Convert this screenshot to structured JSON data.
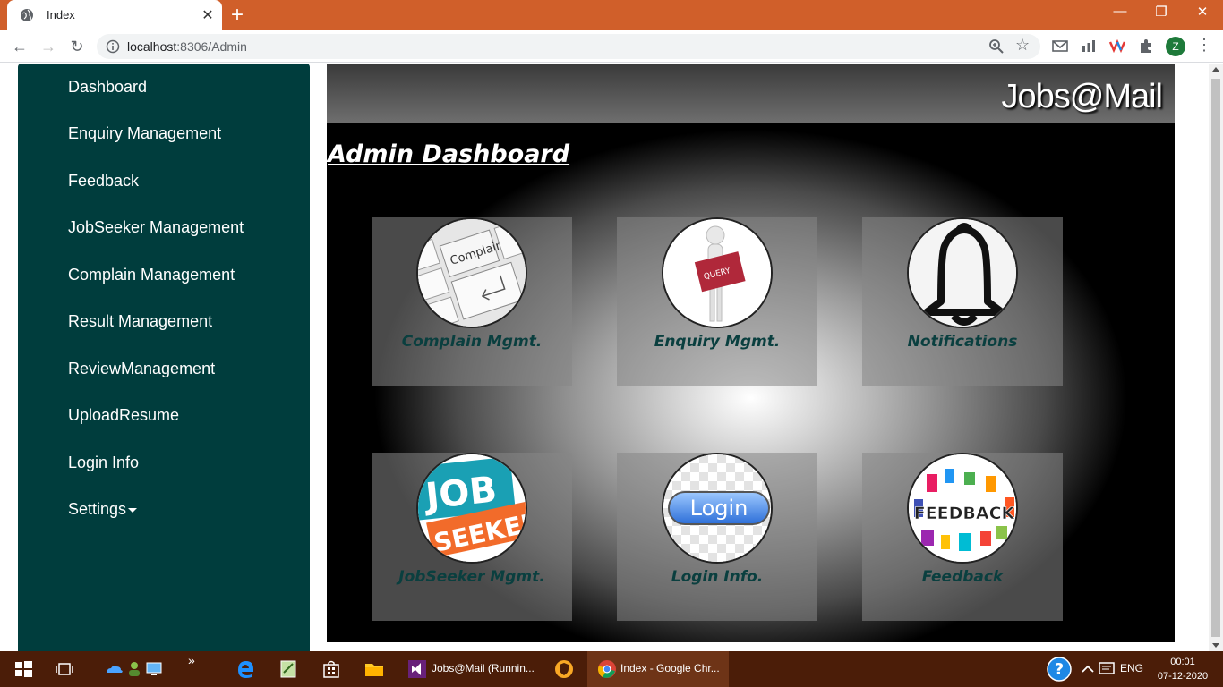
{
  "browser": {
    "tab_title": "Index",
    "tab_close": "✕",
    "new_tab": "+",
    "window_controls": {
      "minimize": "—",
      "restore": "❐",
      "close": "✕"
    },
    "url_host": "localhost",
    "url_path": ":8306/Admin",
    "avatar_letter": "Z",
    "back": "←",
    "forward": "→",
    "reload": "↻",
    "star": "☆",
    "menu": "⋮"
  },
  "sidebar": {
    "items": [
      {
        "label": "Dashboard"
      },
      {
        "label": "Enquiry Management"
      },
      {
        "label": "Feedback"
      },
      {
        "label": "JobSeeker Management"
      },
      {
        "label": "Complain Management"
      },
      {
        "label": "Result Management"
      },
      {
        "label": "ReviewManagement"
      },
      {
        "label": "UploadResume"
      },
      {
        "label": "Login Info"
      },
      {
        "label": "Settings"
      }
    ]
  },
  "header": {
    "brand": "Jobs@Mail"
  },
  "main": {
    "title": "Admin Dashboard",
    "cards": [
      {
        "label": "Complain Mgmt.",
        "icon": "complain-keyboard-icon",
        "icon_text": "Complain"
      },
      {
        "label": "Enquiry Mgmt.",
        "icon": "enquiry-figure-icon",
        "icon_text": "QUERY"
      },
      {
        "label": "Notifications",
        "icon": "bell-icon"
      },
      {
        "label": "JobSeeker Mgmt.",
        "icon": "job-seekers-icon",
        "icon_text_1": "JOB",
        "icon_text_2": "SEEKERS"
      },
      {
        "label": "Login Info.",
        "icon": "login-button-icon",
        "icon_text": "Login"
      },
      {
        "label": "Feedback",
        "icon": "feedback-icon",
        "icon_text": "FEEDBACK"
      }
    ]
  },
  "taskbar": {
    "apps": [
      {
        "name": "Jobs@Mail (Runnin..."
      },
      {
        "name": "Index - Google Chr..."
      }
    ],
    "language": "ENG",
    "time": "00:01",
    "date": "07-12-2020",
    "chevron": "»"
  },
  "colors": {
    "chrome_titlebar": "#d05f2a",
    "sidebar_bg": "#003d3d",
    "card_label": "#0a3f3f",
    "taskbar": "#4b1d08"
  }
}
